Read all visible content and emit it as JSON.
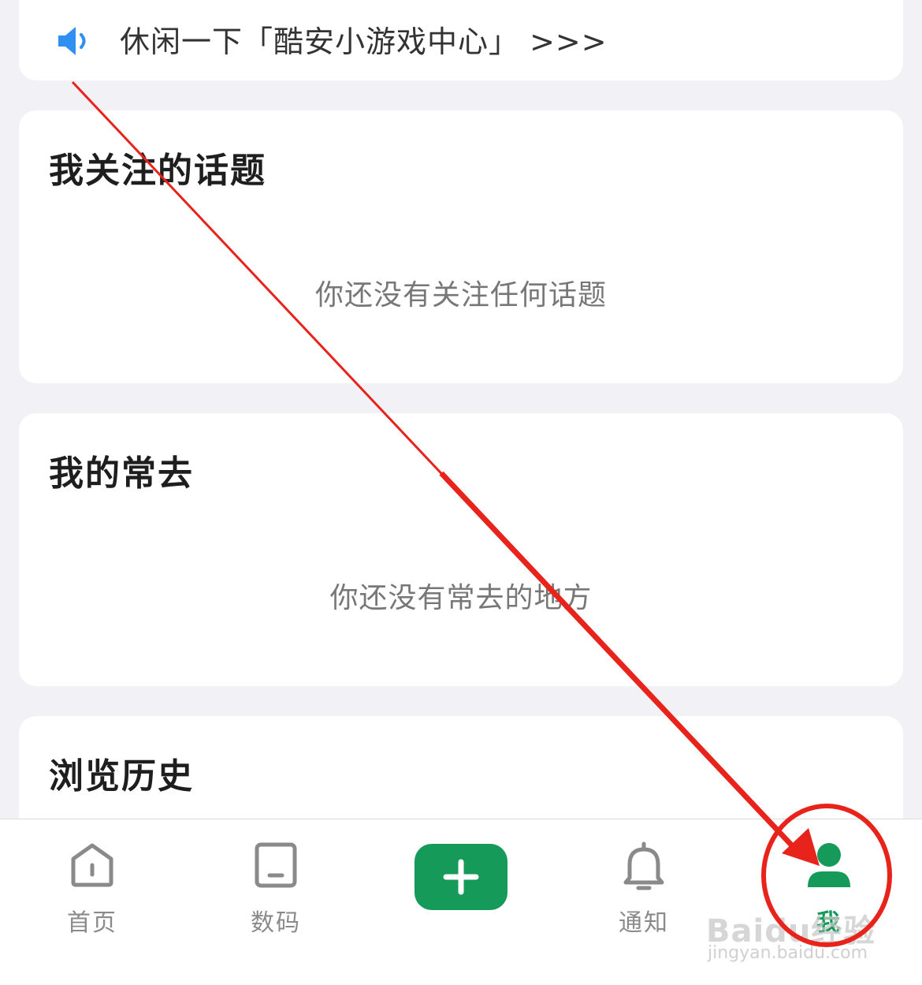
{
  "announcement": {
    "icon": "speaker-icon",
    "text": "休闲一下「酷安小游戏中心」 >>>",
    "icon_color": "#2f8ff2"
  },
  "sections": {
    "topics": {
      "title": "我关注的话题",
      "empty": "你还没有关注任何话题"
    },
    "frequent": {
      "title": "我的常去",
      "empty": "你还没有常去的地方"
    },
    "history": {
      "title": "浏览历史"
    }
  },
  "tabbar": {
    "home": "首页",
    "digital": "数码",
    "notify": "通知",
    "me": "我",
    "active_color": "#169a5a",
    "inactive_color": "#8a8a8a"
  },
  "watermark": {
    "brand": "Baidu经验",
    "url": "jingyan.baidu.com"
  },
  "annotation_color": "#e8231b"
}
